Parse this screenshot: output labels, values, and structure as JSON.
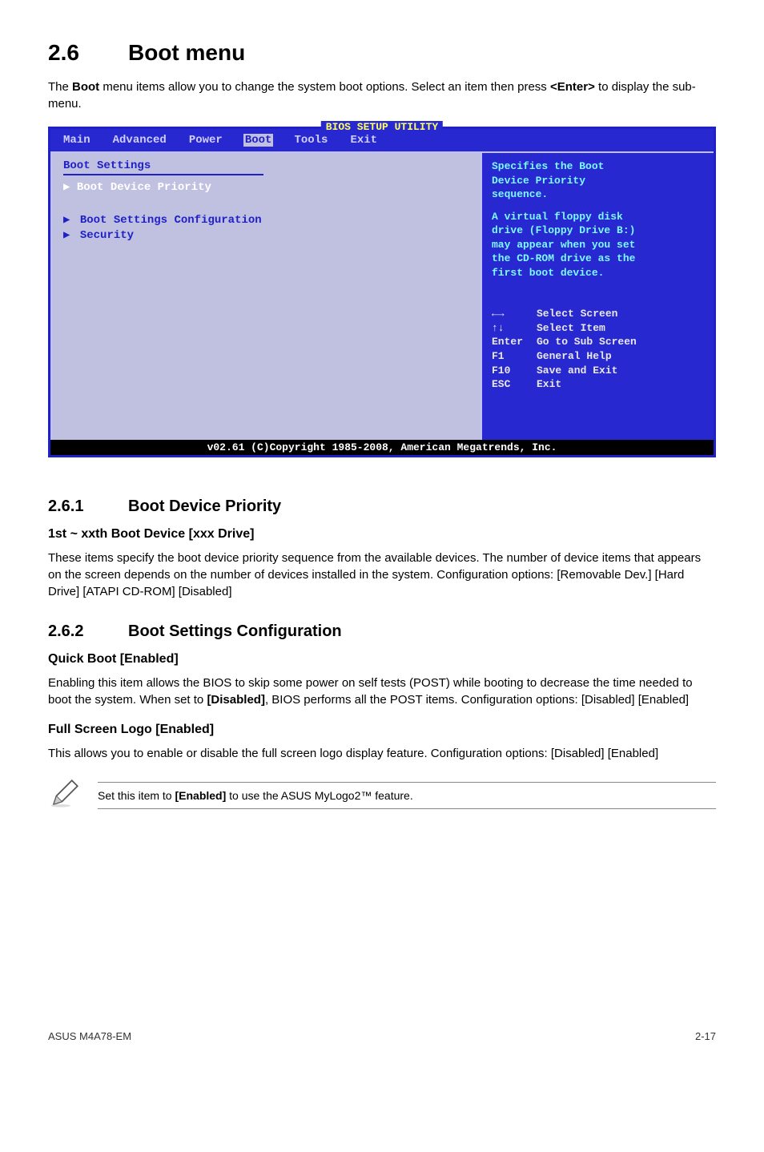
{
  "section": {
    "number": "2.6",
    "title": "Boot menu",
    "intro_pre": "The ",
    "intro_bold1": "Boot",
    "intro_mid": " menu items allow you to change the system boot options. Select an item then press ",
    "intro_bold2": "<Enter>",
    "intro_post": " to display the sub-menu."
  },
  "bios": {
    "top_title": "BIOS SETUP UTILITY",
    "tabs": {
      "main": "Main",
      "advanced": "Advanced",
      "power": "Power",
      "boot": "Boot",
      "tools": "Tools",
      "exit": "Exit"
    },
    "left": {
      "heading": "Boot Settings",
      "item1": "Boot Device Priority",
      "item2": "Boot Settings Configuration",
      "item3": "Security"
    },
    "right": {
      "l1": "Specifies the Boot",
      "l2": "Device Priority",
      "l3": "sequence.",
      "l4": "A virtual floppy disk",
      "l5": "drive (Floppy Drive B:)",
      "l6": "may appear when you set",
      "l7": "the CD-ROM drive as the",
      "l8": "first boot device.",
      "nav_screen": "Select Screen",
      "nav_item": "Select Item",
      "nav_enter_k": "Enter",
      "nav_enter": "Go to Sub Screen",
      "nav_f1_k": "F1",
      "nav_f1": "General Help",
      "nav_f10_k": "F10",
      "nav_f10": "Save and Exit",
      "nav_esc_k": "ESC",
      "nav_esc": "Exit"
    },
    "footer": "v02.61 (C)Copyright 1985-2008, American Megatrends, Inc."
  },
  "sub1": {
    "number": "2.6.1",
    "title": "Boot Device Priority",
    "h": "1st ~ xxth Boot Device [xxx Drive]",
    "p": "These items specify the boot device priority sequence from the available devices. The number of device items that appears on the screen depends on the number of devices installed in the system. Configuration options: [Removable Dev.] [Hard Drive] [ATAPI CD-ROM] [Disabled]"
  },
  "sub2": {
    "number": "2.6.2",
    "title": "Boot Settings Configuration",
    "h1": "Quick Boot [Enabled]",
    "p1a": "Enabling this item allows the BIOS to skip some power on self tests (POST) while booting to decrease the time needed to boot the system. When set to ",
    "p1b": "[Disabled]",
    "p1c": ", BIOS performs all the POST items. Configuration options: [Disabled] [Enabled]",
    "h2": "Full Screen Logo [Enabled]",
    "p2": "This allows you to enable or disable the full screen logo display feature. Configuration options: [Disabled] [Enabled]"
  },
  "note": {
    "pre": "Set this item to ",
    "bold": "[Enabled]",
    "post": " to use the ASUS MyLogo2™ feature."
  },
  "footer": {
    "left": "ASUS M4A78-EM",
    "right": "2-17"
  }
}
